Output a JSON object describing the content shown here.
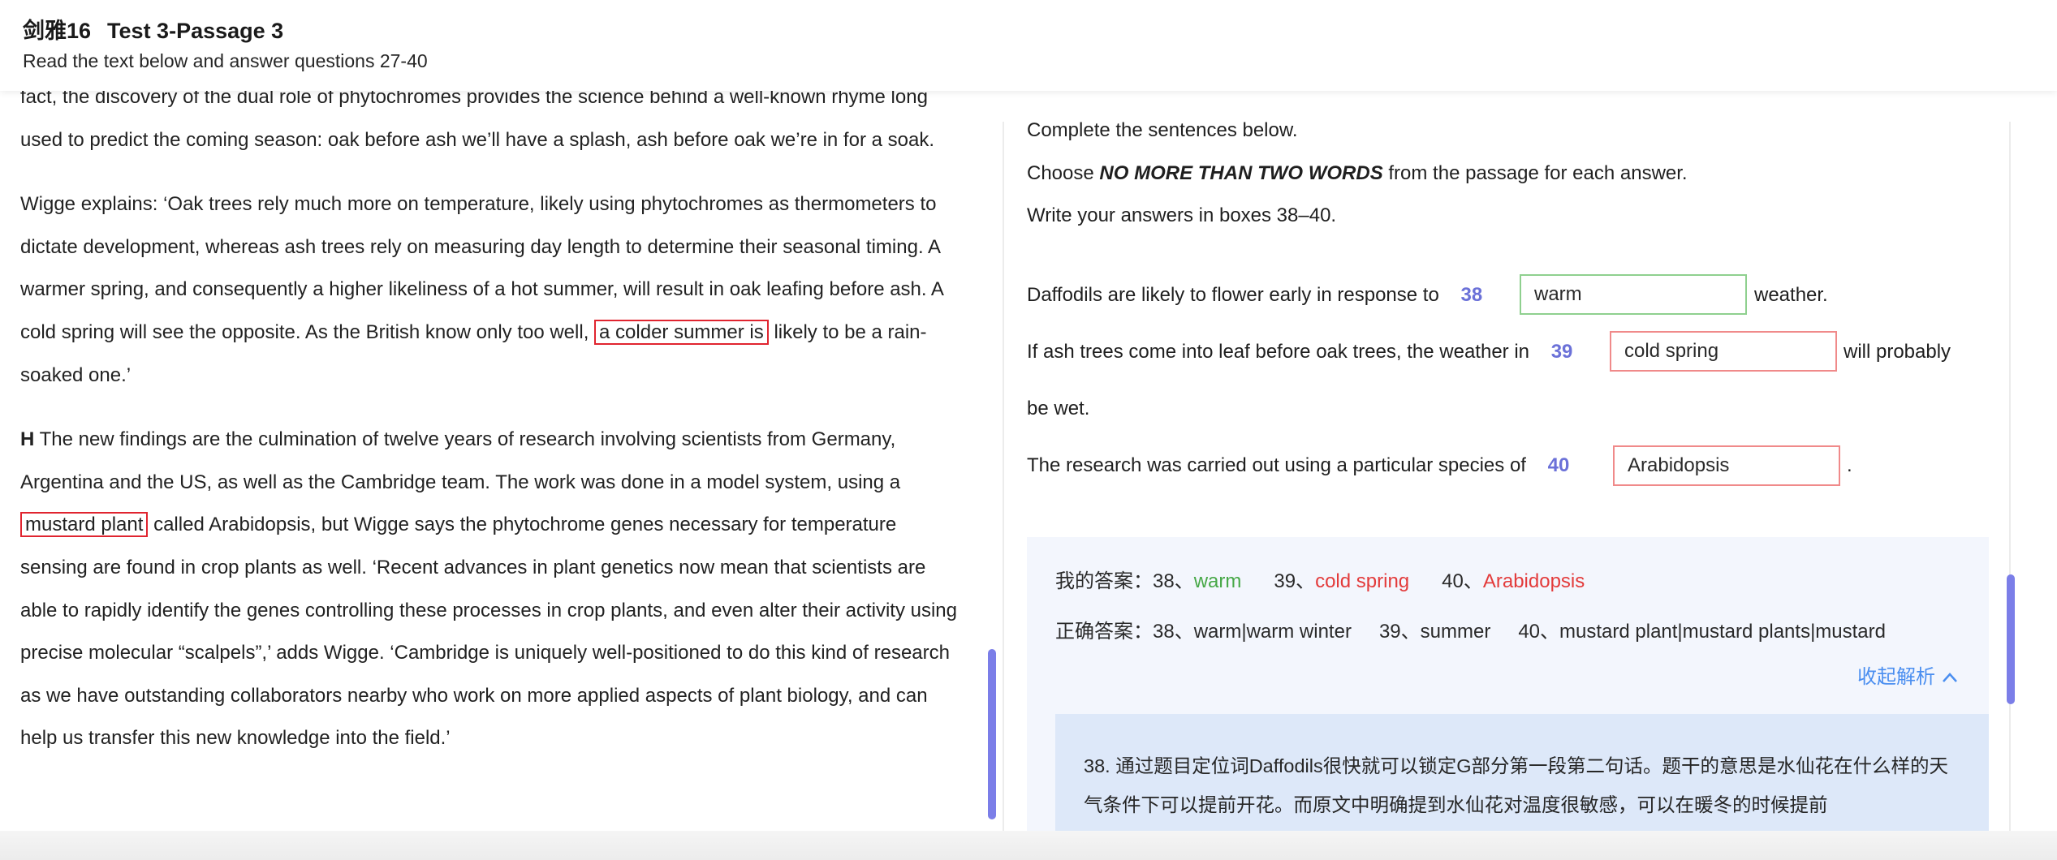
{
  "header": {
    "book": "剑雅16",
    "test": "Test 3-Passage 3",
    "subtitle": "Read the text below and answer questions 27-40"
  },
  "passage": {
    "p1": "fact, the discovery of the dual role of phytochromes provides the science behind a well-known rhyme long used to predict the coming season: oak before ash we’ll have a splash, ash before oak we’re in for a soak.",
    "p2_before": "Wigge explains: ‘Oak trees rely much more on temperature, likely using phytochromes as thermometers to dictate development, whereas ash trees rely on measuring day length to determine their seasonal timing. A warmer spring, and consequently a higher likeliness of a hot summer, will result in oak leafing before ash. A cold spring will see the opposite. As the British know only too well,",
    "p2_highlight": "a colder summer is",
    "p2_after": "likely to be a rain-soaked one.’",
    "p3_letter": "H",
    "p3_before": "The new findings are the culmination of twelve years of research involving scientists from Germany, Argentina and the US, as well as the Cambridge team. The work was done in a model system, using a",
    "p3_highlight": "mustard plant",
    "p3_after": "called Arabidopsis, but Wigge says the phytochrome genes necessary for temperature sensing are found in crop plants as well. ‘Recent advances in plant genetics now mean that scientists are able to rapidly identify the genes controlling these processes in crop plants, and even alter their activity using precise molecular “scalpels”,’ adds Wigge. ‘Cambridge is uniquely well-positioned to do this kind of research as we have outstanding collaborators nearby who work on more applied aspects of plant biology, and can help us transfer this new knowledge into the field.’"
  },
  "instructions": {
    "line1": "Complete the sentences below.",
    "line2_pre": "Choose",
    "line2_bold": "NO MORE THAN TWO WORDS",
    "line2_post": "from the passage for each answer.",
    "line3": "Write your answers in boxes 38–40."
  },
  "questions": [
    {
      "num": "38",
      "pre": "Daffodils are likely to flower early in response to",
      "answer": "warm",
      "post": "weather."
    },
    {
      "num": "39",
      "pre": "If ash trees come into leaf before oak trees, the weather in",
      "answer": "cold spring",
      "post": "will probably",
      "cont": "be wet."
    },
    {
      "num": "40",
      "pre": "The research was carried out using a particular species of",
      "answer": "Arabidopsis",
      "post": "."
    }
  ],
  "my_answers": {
    "label": "我的答案：",
    "a38": "38、",
    "v38": "warm",
    "a39": "39、",
    "v39": "cold spring",
    "a40": "40、",
    "v40": "Arabidopsis"
  },
  "correct_answers": {
    "label": "正确答案：",
    "a38": "38、warm|warm winter",
    "a39": "39、summer",
    "a40": "40、mustard plant|mustard plants|mustard"
  },
  "collapse_label": "收起解析",
  "analysis_text": "38. 通过题目定位词Daffodils很快就可以锁定G部分第一段第二句话。题干的意思是水仙花在什么样的天气条件下可以提前开花。而原文中明确提到水仙花对温度很敏感，可以在暖冬的时候提前",
  "colors": {
    "accent": "#6b71d8",
    "correct": "#47a847",
    "wrong": "#e33b3b",
    "link": "#4a8ef0"
  }
}
